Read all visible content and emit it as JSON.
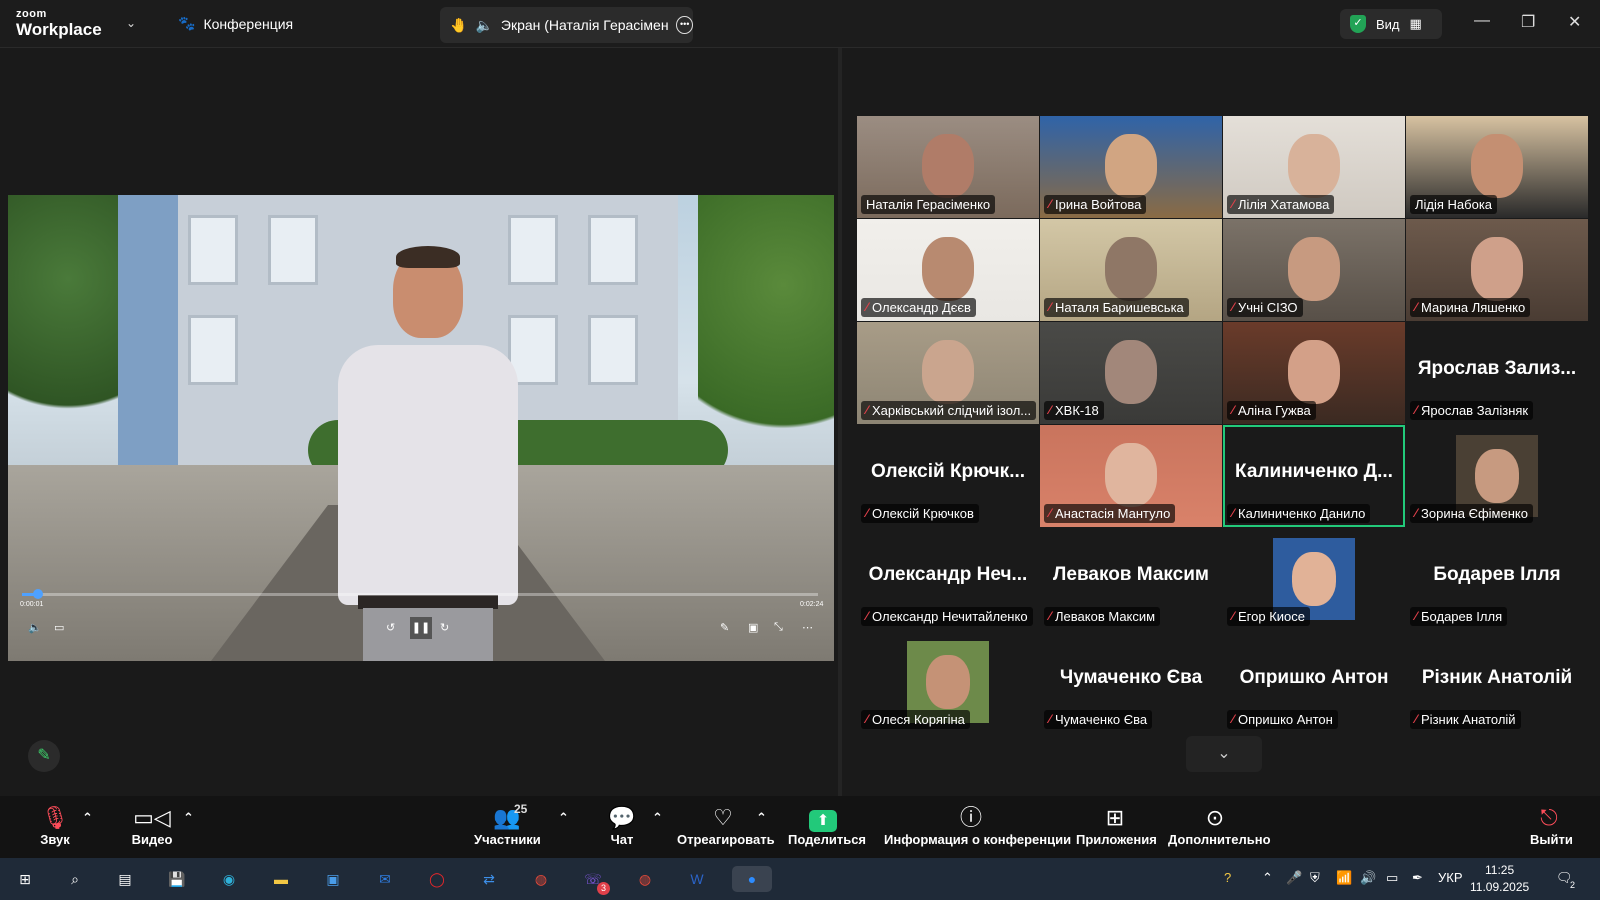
{
  "app": {
    "logo_line1": "zoom",
    "logo_line2": "Workplace",
    "conference_label": "Конференция",
    "share_title": "Экран (Наталія Герасіменко)",
    "view_label": "Вид"
  },
  "video": {
    "elapsed": "0:00:01",
    "duration": "0:02:24",
    "progress_fraction": 0.02
  },
  "participants": [
    {
      "name": "Наталія Герасіменко",
      "muted": false,
      "video": true,
      "bg": "#7b6a5c",
      "face": "#b07c68",
      "wall": "#9b8d82"
    },
    {
      "name": "Ірина Войтова",
      "muted": true,
      "video": true,
      "bg": "#8a6b44",
      "face": "#d1a582",
      "wall": "#2f63a8"
    },
    {
      "name": "Лілія Хатамова",
      "muted": true,
      "video": true,
      "bg": "#cfc9c1",
      "face": "#d8b29a",
      "wall": "#e4dfd8"
    },
    {
      "name": "Лідія Набока",
      "muted": false,
      "video": true,
      "bg": "#2a2a2a",
      "face": "#c48f72",
      "wall": "#d7c2a1"
    },
    {
      "name": "Олександр Дєєв",
      "muted": true,
      "video": true,
      "bg": "#e9e7e3",
      "face": "#b88a70",
      "wall": "#f1efeb"
    },
    {
      "name": "Наталя Баришевська",
      "muted": true,
      "video": true,
      "bg": "#b4a583",
      "face": "#8f7766",
      "wall": "#d3c7a6"
    },
    {
      "name": "Учні СІЗО",
      "muted": true,
      "video": true,
      "bg": "#585048",
      "face": "#c79a80",
      "wall": "#7b7268"
    },
    {
      "name": "Марина Ляшенко",
      "muted": true,
      "video": true,
      "bg": "#4a3c33",
      "face": "#cfa08a",
      "wall": "#6d5a4c"
    },
    {
      "name": "Харківський слідчий ізол...",
      "muted": true,
      "video": true,
      "bg": "#8d8574",
      "face": "#caa58e",
      "wall": "#a89c87"
    },
    {
      "name": "ХВК-18",
      "muted": true,
      "video": true,
      "bg": "#3a3a38",
      "face": "#a2877a",
      "wall": "#4a4a47"
    },
    {
      "name": "Аліна Гужва",
      "muted": true,
      "video": true,
      "bg": "#3b2a22",
      "face": "#d3a088",
      "wall": "#6a3b2a"
    },
    {
      "name": "Ярослав Залізняк",
      "big": "Ярослав Зализ...",
      "muted": true,
      "video": false
    },
    {
      "name": "Олексій Крючков",
      "big": "Олексій Крючк...",
      "muted": true,
      "video": false
    },
    {
      "name": "Анастасія Мантуло",
      "muted": true,
      "video": true,
      "bg": "#d9826a",
      "face": "#e0b59e",
      "wall": "#c9745d"
    },
    {
      "name": "Калиниченко Данило",
      "big": "Калиниченко Д...",
      "muted": true,
      "video": false,
      "active": true
    },
    {
      "name": "Зорина Єфіменко",
      "muted": true,
      "video": false,
      "avatar": true,
      "bg": "#4a4034",
      "face": "#c79a80"
    },
    {
      "name": "Олександр Нечитайленко",
      "big": "Олександр Неч...",
      "muted": true,
      "video": false
    },
    {
      "name": "Леваков Максим",
      "big": "Леваков Максим",
      "muted": true,
      "video": false
    },
    {
      "name": "Егор Киосе",
      "muted": true,
      "video": false,
      "avatar": true,
      "bg": "#2e5c9e",
      "face": "#e1b297"
    },
    {
      "name": "Бодарев Ілля",
      "big": "Бодарев Ілля",
      "muted": true,
      "video": false
    },
    {
      "name": "Олеся Корягіна",
      "muted": true,
      "video": false,
      "avatar": true,
      "bg": "#6d8a4a",
      "face": "#c59276"
    },
    {
      "name": "Чумаченко Єва",
      "big": "Чумаченко Єва",
      "muted": true,
      "video": false
    },
    {
      "name": "Опришко Антон",
      "big": "Опришко Антон",
      "muted": true,
      "video": false
    },
    {
      "name": "Різник Анатолій",
      "big": "Різник Анатолій",
      "muted": true,
      "video": false
    }
  ],
  "toolbar": {
    "audio": "Звук",
    "video": "Видео",
    "participants": "Участники",
    "participants_count": "25",
    "chat": "Чат",
    "react": "Отреагировать",
    "share": "Поделиться",
    "info": "Информация о конференции",
    "apps": "Приложения",
    "more": "Дополнительно",
    "leave": "Выйти"
  },
  "taskbar": {
    "lang": "УКР",
    "time": "11:25",
    "date": "11.09.2025",
    "notif_count": "2",
    "viber_badge": "3"
  },
  "colors": {
    "accent_green": "#22c97a",
    "mute_red": "#e0404a",
    "progress_blue": "#4ea1ff"
  }
}
